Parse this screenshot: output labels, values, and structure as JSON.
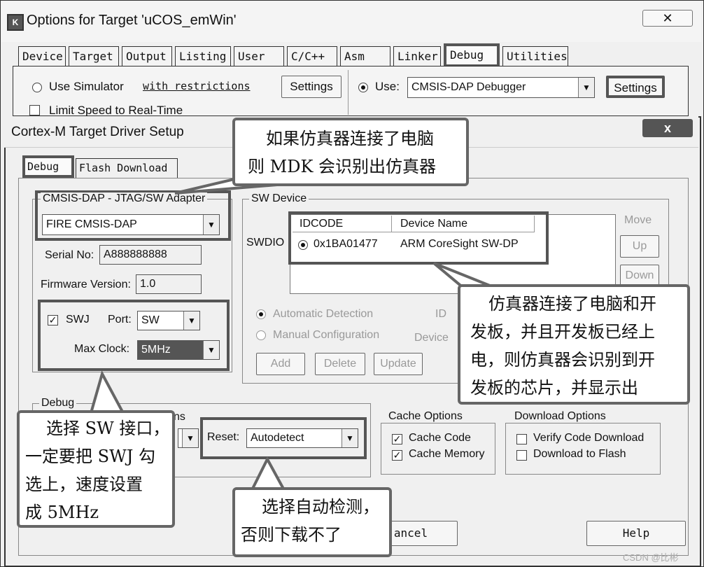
{
  "outer_window": {
    "title": "Options for Target 'uCOS_emWin'",
    "close": "✕",
    "tabs": [
      "Device",
      "Target",
      "Output",
      "Listing",
      "User",
      "C/C++",
      "Asm",
      "Linker",
      "Debug",
      "Utilities"
    ],
    "active_tab": "Debug",
    "use_simulator": "Use Simulator",
    "with_restrictions": "with restrictions",
    "settings_left": "Settings",
    "limit_speed": "Limit Speed to Real-Time",
    "use_label": "Use:",
    "debugger": "CMSIS-DAP Debugger",
    "settings_right": "Settings"
  },
  "inner_dialog": {
    "title": "Cortex-M Target Driver Setup",
    "close": "x",
    "tabs": [
      "Debug",
      "Flash Download"
    ],
    "adapter": {
      "legend": "CMSIS-DAP - JTAG/SW Adapter",
      "selected": "FIRE CMSIS-DAP",
      "serial_label": "Serial No:",
      "serial_value": "A888888888",
      "firmware_label": "Firmware Version:",
      "firmware_value": "1.0",
      "swj_label": "SWJ",
      "port_label": "Port:",
      "port_value": "SW",
      "max_clock_label": "Max Clock:",
      "max_clock_value": "5MHz"
    },
    "sw_device": {
      "legend": "SW Device",
      "columns": [
        "IDCODE",
        "Device Name"
      ],
      "swdio_label": "SWDIO",
      "rows": [
        {
          "idcode": "0x1BA01477",
          "device": "ARM CoreSight SW-DP"
        }
      ],
      "move_label": "Move",
      "up": "Up",
      "down": "Down",
      "automatic_detection": "Automatic Detection",
      "manual_configuration": "Manual Configuration",
      "id_label": "ID",
      "device_label": "Device",
      "add": "Add",
      "delete": "Delete",
      "update": "Update"
    },
    "debug_group": {
      "legend": "Debug",
      "options_fragment": "ns",
      "reset_label": "Reset:",
      "reset_value": "Autodetect"
    },
    "cache_options": {
      "legend": "Cache Options",
      "items": [
        "Cache Code",
        "Cache Memory"
      ]
    },
    "download_options": {
      "legend": "Download Options",
      "items": [
        "Verify Code Download",
        "Download to Flash"
      ]
    },
    "cancel_fragment": "ancel",
    "help": "Help"
  },
  "callouts": {
    "top": [
      "如果仿真器连接了电脑",
      "则 MDK 会识别出仿真器"
    ],
    "right": [
      "仿真器连接了电脑和开",
      "发板，并且开发板已经上",
      "电，则仿真器会识别到开",
      "发板的芯片，并显示出"
    ],
    "left": [
      "选择 SW 接口，",
      "一定要把 SWJ 勾",
      "选上，速度设置",
      "成 5MHz"
    ],
    "bottom": [
      "选择自动检测，",
      "否则下载不了"
    ]
  },
  "watermark": "CSDN @比彬"
}
